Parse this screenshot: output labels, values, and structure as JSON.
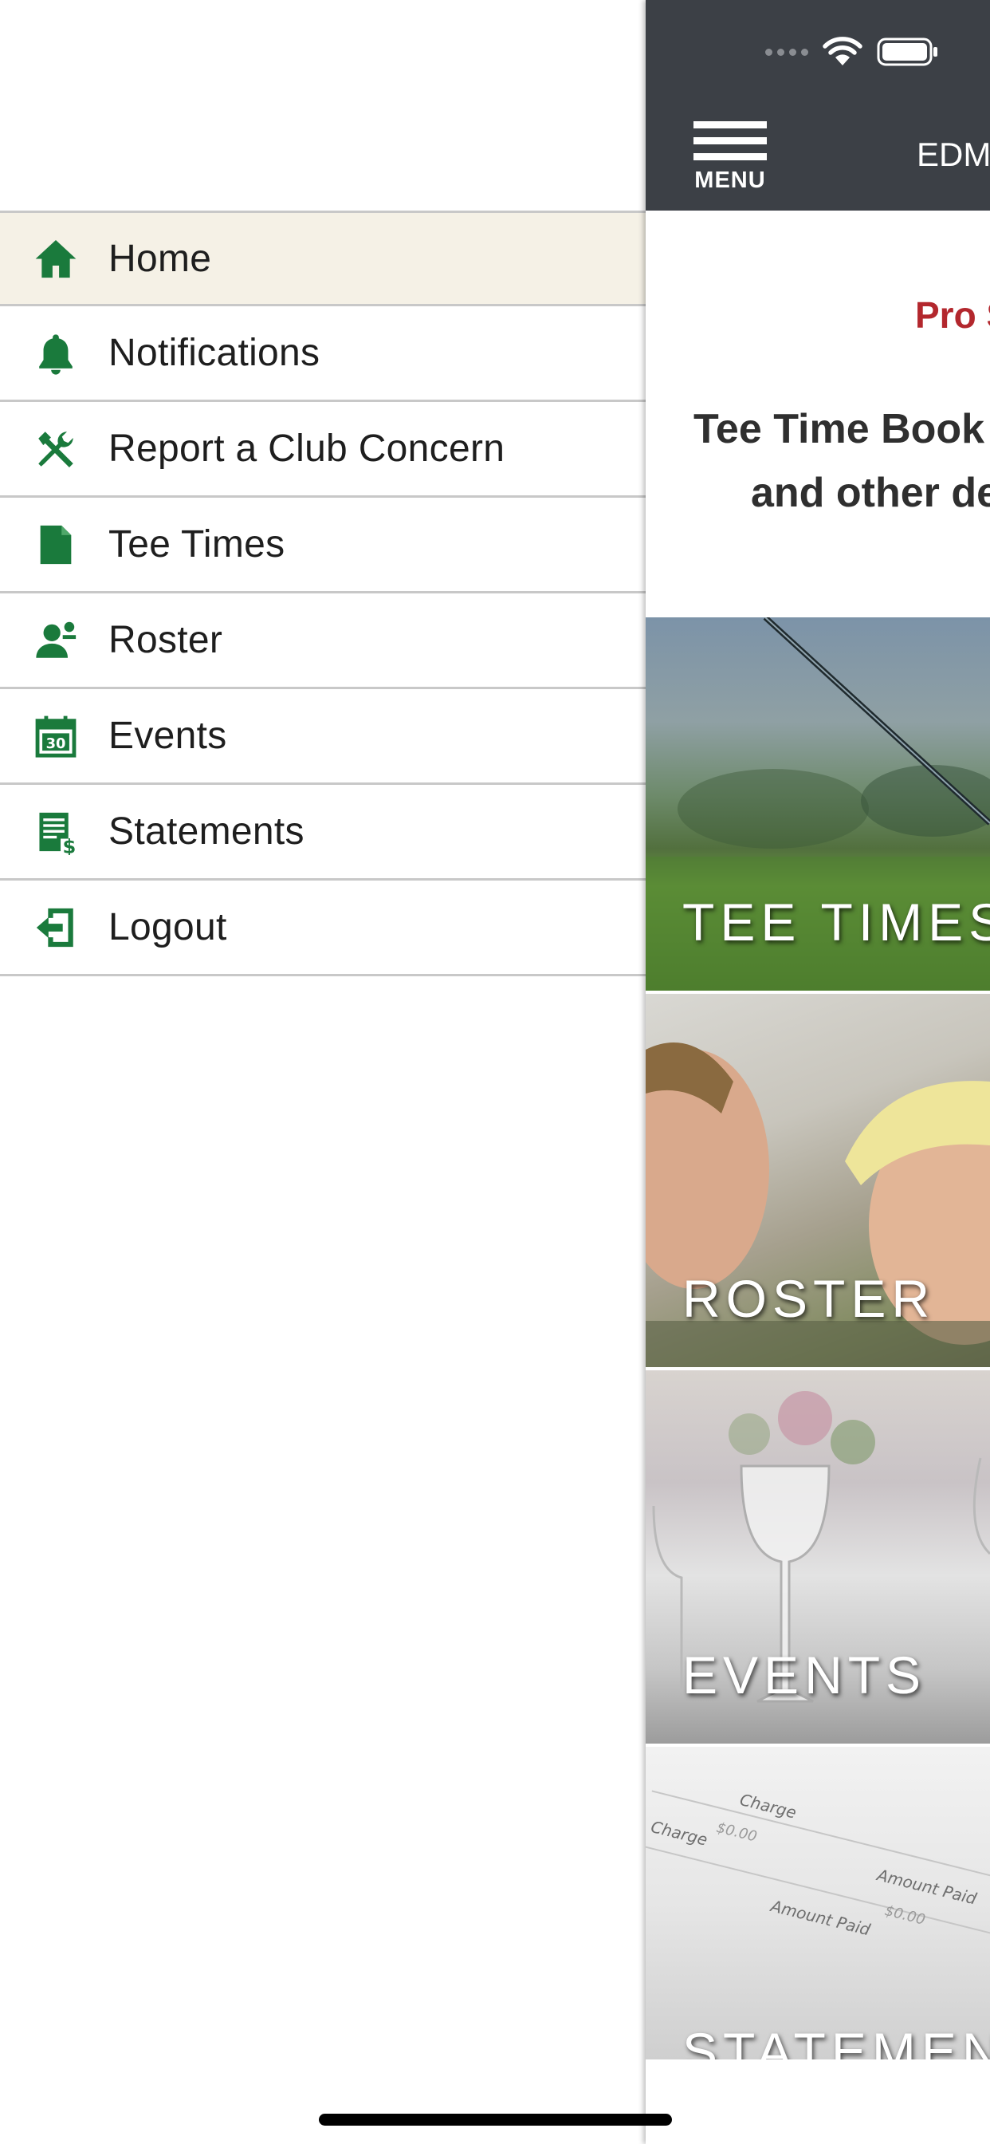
{
  "menu": {
    "items": [
      {
        "label": "Home",
        "icon": "home-icon",
        "active": true
      },
      {
        "label": "Notifications",
        "icon": "bell-icon"
      },
      {
        "label": "Report a Club Concern",
        "icon": "tools-icon"
      },
      {
        "label": "Tee Times",
        "icon": "document-icon"
      },
      {
        "label": "Roster",
        "icon": "person-icon"
      },
      {
        "label": "Events",
        "icon": "calendar-icon",
        "calendar_day": "30"
      },
      {
        "label": "Statements",
        "icon": "statement-icon"
      },
      {
        "label": "Logout",
        "icon": "logout-icon"
      }
    ],
    "icon_color": "#1a7a3c"
  },
  "header": {
    "menu_label": "MENU",
    "title": "EDM"
  },
  "notice": {
    "title": "Pro S",
    "line1": "Tee Time Book",
    "line2": "and other de"
  },
  "tiles": {
    "tee_times": "TEE TIMES",
    "roster": "ROSTER",
    "events": "EVENTS",
    "statements": "STATEMEN",
    "statement_paper": {
      "charge": "Charge",
      "amount_paid": "Amount Paid",
      "value": "$0.00"
    }
  }
}
